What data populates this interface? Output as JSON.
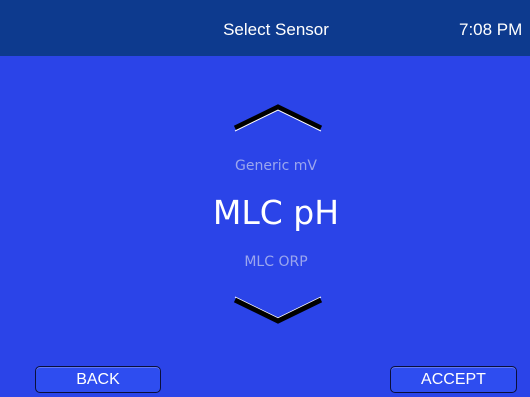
{
  "header": {
    "title": "Select Sensor",
    "time": "7:08 PM"
  },
  "selector": {
    "previous_option": "Generic mV",
    "current_option": "MLC pH",
    "next_option": "MLC ORP"
  },
  "icons": {
    "up": "chevron-up-icon",
    "down": "chevron-down-icon"
  },
  "buttons": {
    "back_label": "BACK",
    "accept_label": "ACCEPT"
  },
  "colors": {
    "header_bar": "#0D3A8E",
    "background": "#2B44E8",
    "dim_text": "#9BA6EE",
    "text": "#FFFFFF"
  }
}
